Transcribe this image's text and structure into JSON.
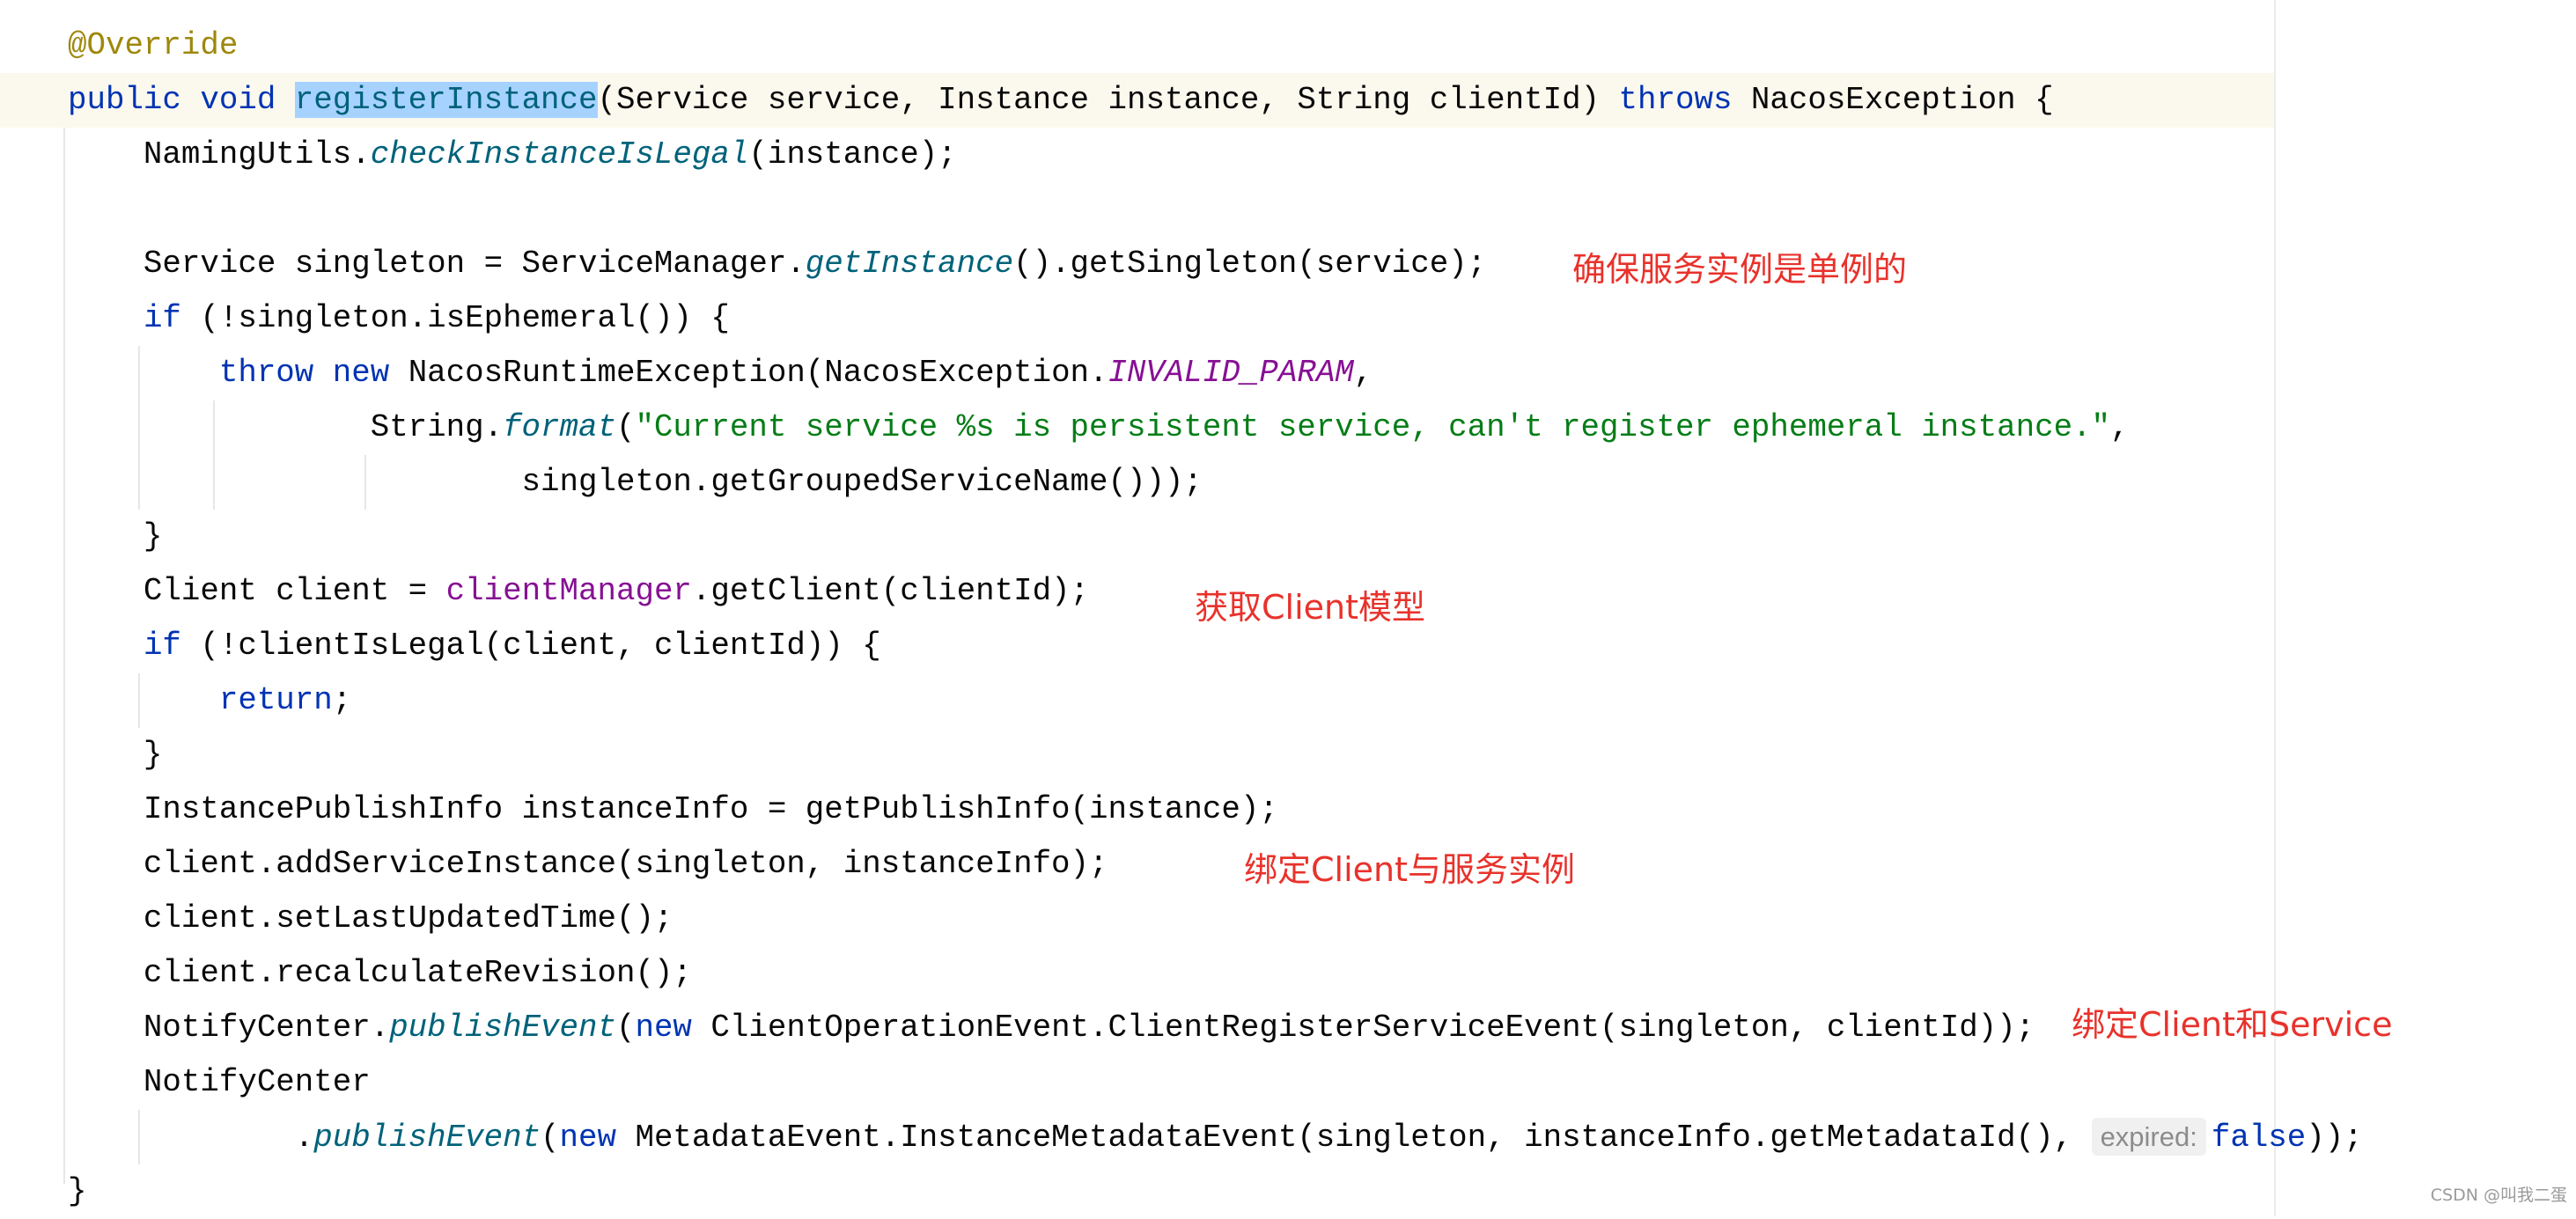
{
  "editor": {
    "language": "Java",
    "lines": [
      [
        {
          "t": "@Override",
          "c": "ann"
        }
      ],
      [
        {
          "t": "public",
          "c": "kw"
        },
        {
          "t": " "
        },
        {
          "t": "void",
          "c": "kw"
        },
        {
          "t": " "
        },
        {
          "t": "registerInstance",
          "c": "fn-decl"
        },
        {
          "t": "(Service service, Instance instance, String clientId) "
        },
        {
          "t": "throws",
          "c": "kw"
        },
        {
          "t": " NacosException {"
        }
      ],
      [
        {
          "t": "    NamingUtils."
        },
        {
          "t": "checkInstanceIsLegal",
          "c": "static-call"
        },
        {
          "t": "(instance);"
        }
      ],
      [],
      [
        {
          "t": "    Service singleton = ServiceManager."
        },
        {
          "t": "getInstance",
          "c": "static-call"
        },
        {
          "t": "().getSingleton(service);"
        }
      ],
      [
        {
          "t": "    "
        },
        {
          "t": "if",
          "c": "kw"
        },
        {
          "t": " (!singleton.isEphemeral()) {"
        }
      ],
      [
        {
          "t": "        "
        },
        {
          "t": "throw",
          "c": "kw"
        },
        {
          "t": " "
        },
        {
          "t": "new",
          "c": "kw"
        },
        {
          "t": " NacosRuntimeException(NacosException."
        },
        {
          "t": "INVALID_PARAM",
          "c": "const"
        },
        {
          "t": ","
        }
      ],
      [
        {
          "t": "                String."
        },
        {
          "t": "format",
          "c": "static-call"
        },
        {
          "t": "("
        },
        {
          "t": "\"Current service %s is persistent service, can't register ephemeral instance.\"",
          "c": "str"
        },
        {
          "t": ","
        }
      ],
      [
        {
          "t": "                        singleton.getGroupedServiceName()));"
        }
      ],
      [
        {
          "t": "    }"
        }
      ],
      [
        {
          "t": "    Client client = "
        },
        {
          "t": "clientManager",
          "c": "field"
        },
        {
          "t": ".getClient(clientId);"
        }
      ],
      [
        {
          "t": "    "
        },
        {
          "t": "if",
          "c": "kw"
        },
        {
          "t": " (!clientIsLegal(client, clientId)) {"
        }
      ],
      [
        {
          "t": "        "
        },
        {
          "t": "return",
          "c": "kw"
        },
        {
          "t": ";"
        }
      ],
      [
        {
          "t": "    }"
        }
      ],
      [
        {
          "t": "    InstancePublishInfo instanceInfo = getPublishInfo(instance);"
        }
      ],
      [
        {
          "t": "    client.addServiceInstance(singleton, instanceInfo);"
        }
      ],
      [
        {
          "t": "    client.setLastUpdatedTime();"
        }
      ],
      [
        {
          "t": "    client.recalculateRevision();"
        }
      ],
      [
        {
          "t": "    NotifyCenter."
        },
        {
          "t": "publishEvent",
          "c": "static-call"
        },
        {
          "t": "("
        },
        {
          "t": "new",
          "c": "kw"
        },
        {
          "t": " ClientOperationEvent.ClientRegisterServiceEvent(singleton, clientId));"
        }
      ],
      [
        {
          "t": "    NotifyCenter"
        }
      ],
      [
        {
          "t": "            ."
        },
        {
          "t": "publishEvent",
          "c": "static-call"
        },
        {
          "t": "("
        },
        {
          "t": "new",
          "c": "kw"
        },
        {
          "t": " MetadataEvent.InstanceMetadataEvent(singleton, instanceInfo.getMetadataId(), "
        },
        {
          "t": "expired:",
          "c": "hint"
        },
        {
          "t": "false",
          "c": "kw"
        },
        {
          "t": "));"
        }
      ],
      [
        {
          "t": "}"
        }
      ]
    ]
  },
  "annotations": [
    {
      "text": "确保服务实例是单例的",
      "line": 4
    },
    {
      "text": "获取Client模型",
      "line": 10
    },
    {
      "text": "绑定Client与服务实例",
      "line": 15
    },
    {
      "text": "绑定Client和Service",
      "line": 18
    }
  ],
  "colors": {
    "keyword": "#0033b3",
    "annotation": "#9e880d",
    "method_declaration": "#00627a",
    "selection": "#a6d2ff",
    "string": "#067d17",
    "constant_field": "#871094",
    "note_red": "#e8322b",
    "current_line": "#fbf9ee"
  },
  "watermark": "CSDN @叫我二蛋"
}
